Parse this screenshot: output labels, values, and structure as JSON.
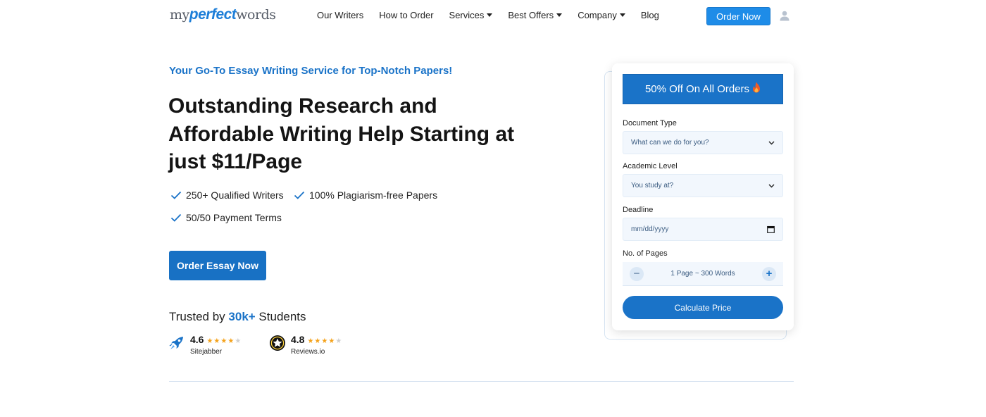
{
  "header": {
    "logo": {
      "part1": "my",
      "part2": "perfect",
      "part3": "words"
    },
    "nav": [
      {
        "label": "Our Writers",
        "has_caret": false
      },
      {
        "label": "How to Order",
        "has_caret": false
      },
      {
        "label": "Services",
        "has_caret": true
      },
      {
        "label": "Best Offers",
        "has_caret": true
      },
      {
        "label": "Company",
        "has_caret": true
      },
      {
        "label": "Blog",
        "has_caret": false
      }
    ],
    "order_button": "Order Now",
    "user_icon": "user-icon"
  },
  "hero": {
    "tagline": "Your Go-To Essay Writing Service for Top-Notch Papers!",
    "headline": "Outstanding Research and Affordable Writing Help Starting at just $11/Page",
    "features": [
      "250+ Qualified Writers",
      "100% Plagiarism-free Papers",
      "50/50 Payment Terms"
    ],
    "cta": "Order Essay Now",
    "trusted": {
      "prefix": "Trusted by ",
      "highlight": "30k+",
      "suffix": " Students"
    },
    "reviews": [
      {
        "score": "4.6",
        "name": "Sitejabber",
        "stars": 4,
        "icon": "rocket-icon"
      },
      {
        "score": "4.8",
        "name": "Reviews.io",
        "stars": 4,
        "icon": "star-badge-icon"
      }
    ]
  },
  "order_form": {
    "promo": "50% Off On All Orders",
    "promo_icon": "flame-icon",
    "document_type": {
      "label": "Document Type",
      "placeholder": "What can we do for you?"
    },
    "academic_level": {
      "label": "Academic Level",
      "placeholder": "You study at?"
    },
    "deadline": {
      "label": "Deadline",
      "placeholder": "mm/dd/yyyy"
    },
    "pages": {
      "label": "No. of Pages",
      "value": "1 Page ~ 300 Words",
      "minus": "−",
      "plus": "+"
    },
    "submit": "Calculate Price"
  },
  "colors": {
    "primary": "#1a73c8",
    "button_light": "#1e8ce8",
    "star": "#f4a21a",
    "field_bg": "#f2f7fd"
  }
}
